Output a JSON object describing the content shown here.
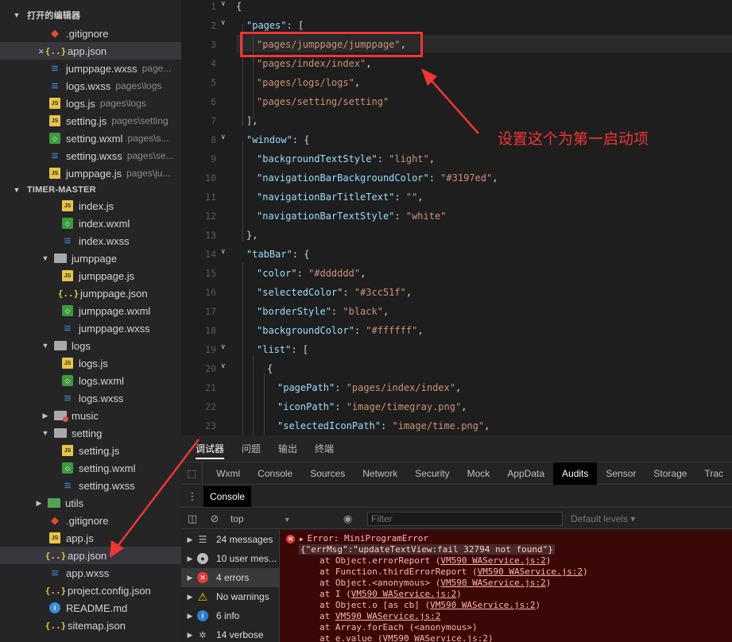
{
  "sidebar": {
    "open_editors_title": "打开的编辑器",
    "project_title": "TIMER-MASTER",
    "open_editors": [
      {
        "name": ".gitignore",
        "path": "",
        "icon": "git-icon",
        "closable": false
      },
      {
        "name": "app.json",
        "path": "",
        "icon": "json-icon",
        "closable": true,
        "selected": true
      },
      {
        "name": "jumppage.wxss",
        "path": "page...",
        "icon": "wxss-icon"
      },
      {
        "name": "logs.wxss",
        "path": "pages\\logs",
        "icon": "wxss-icon"
      },
      {
        "name": "logs.js",
        "path": "pages\\logs",
        "icon": "js-icon"
      },
      {
        "name": "setting.js",
        "path": "pages\\setting",
        "icon": "js-icon"
      },
      {
        "name": "setting.wxml",
        "path": "pages\\s...",
        "icon": "wxml-icon"
      },
      {
        "name": "setting.wxss",
        "path": "pages\\se...",
        "icon": "wxss-icon"
      },
      {
        "name": "jumppage.js",
        "path": "pages\\ju...",
        "icon": "js-icon"
      }
    ],
    "tree": [
      {
        "name": "index.js",
        "icon": "js-icon",
        "indent": 2
      },
      {
        "name": "index.wxml",
        "icon": "wxml-icon",
        "indent": 2
      },
      {
        "name": "index.wxss",
        "icon": "wxss-icon",
        "indent": 2
      },
      {
        "name": "jumppage",
        "icon": "folder-icon",
        "indent": 1,
        "expanded": true
      },
      {
        "name": "jumppage.js",
        "icon": "js-icon",
        "indent": 2
      },
      {
        "name": "jumppage.json",
        "icon": "json-icon",
        "indent": 2
      },
      {
        "name": "jumppage.wxml",
        "icon": "wxml-icon",
        "indent": 2
      },
      {
        "name": "jumppage.wxss",
        "icon": "wxss-icon",
        "indent": 2
      },
      {
        "name": "logs",
        "icon": "folder-icon",
        "indent": 1,
        "expanded": true
      },
      {
        "name": "logs.js",
        "icon": "js-icon",
        "indent": 2
      },
      {
        "name": "logs.wxml",
        "icon": "wxml-icon",
        "indent": 2
      },
      {
        "name": "logs.wxss",
        "icon": "wxss-icon",
        "indent": 2
      },
      {
        "name": "music",
        "icon": "folder-icon",
        "indent": 1,
        "expanded": false
      },
      {
        "name": "setting",
        "icon": "folder-icon",
        "indent": 1,
        "expanded": true
      },
      {
        "name": "setting.js",
        "icon": "js-icon",
        "indent": 2
      },
      {
        "name": "setting.wxml",
        "icon": "wxml-icon",
        "indent": 2
      },
      {
        "name": "setting.wxss",
        "icon": "wxss-icon",
        "indent": 2
      },
      {
        "name": "utils",
        "icon": "folder-icon",
        "indent": 0,
        "expanded": false
      },
      {
        "name": ".gitignore",
        "icon": "git-icon",
        "indent": 0
      },
      {
        "name": "app.js",
        "icon": "js-icon",
        "indent": 0
      },
      {
        "name": "app.json",
        "icon": "json-icon",
        "indent": 0,
        "selected": true
      },
      {
        "name": "app.wxss",
        "icon": "wxss-icon",
        "indent": 0
      },
      {
        "name": "project.config.json",
        "icon": "json-icon",
        "indent": 0
      },
      {
        "name": "README.md",
        "icon": "info-icon",
        "indent": 0
      },
      {
        "name": "sitemap.json",
        "icon": "json-icon",
        "indent": 0
      }
    ]
  },
  "editor": {
    "lines": [
      {
        "n": "1",
        "fold": true,
        "code": [
          [
            "p",
            "{"
          ]
        ]
      },
      {
        "n": "2",
        "fold": true,
        "indent": 1,
        "code": [
          [
            "k",
            "\"pages\""
          ],
          [
            "p",
            ": ["
          ]
        ]
      },
      {
        "n": "3",
        "indent": 2,
        "code": [
          [
            "s",
            "\"pages/jumppage/jumppage\""
          ],
          [
            "p",
            ","
          ]
        ]
      },
      {
        "n": "4",
        "indent": 2,
        "code": [
          [
            "s",
            "\"pages/index/index\""
          ],
          [
            "p",
            ","
          ]
        ]
      },
      {
        "n": "5",
        "indent": 2,
        "code": [
          [
            "s",
            "\"pages/logs/logs\""
          ],
          [
            "p",
            ","
          ]
        ]
      },
      {
        "n": "6",
        "indent": 2,
        "code": [
          [
            "s",
            "\"pages/setting/setting\""
          ]
        ]
      },
      {
        "n": "7",
        "indent": 1,
        "code": [
          [
            "p",
            "],"
          ]
        ]
      },
      {
        "n": "8",
        "fold": true,
        "indent": 1,
        "code": [
          [
            "k",
            "\"window\""
          ],
          [
            "p",
            ": {"
          ]
        ]
      },
      {
        "n": "9",
        "indent": 2,
        "code": [
          [
            "k",
            "\"backgroundTextStyle\""
          ],
          [
            "p",
            ": "
          ],
          [
            "s",
            "\"light\""
          ],
          [
            "p",
            ","
          ]
        ]
      },
      {
        "n": "10",
        "indent": 2,
        "code": [
          [
            "k",
            "\"navigationBarBackgroundColor\""
          ],
          [
            "p",
            ": "
          ],
          [
            "s",
            "\"#3197ed\""
          ],
          [
            "p",
            ","
          ]
        ]
      },
      {
        "n": "11",
        "indent": 2,
        "code": [
          [
            "k",
            "\"navigationBarTitleText\""
          ],
          [
            "p",
            ": "
          ],
          [
            "s",
            "\"\""
          ],
          [
            "p",
            ","
          ]
        ]
      },
      {
        "n": "12",
        "indent": 2,
        "code": [
          [
            "k",
            "\"navigationBarTextStyle\""
          ],
          [
            "p",
            ": "
          ],
          [
            "s",
            "\"white\""
          ]
        ]
      },
      {
        "n": "13",
        "indent": 1,
        "code": [
          [
            "p",
            "},"
          ]
        ]
      },
      {
        "n": "14",
        "fold": true,
        "indent": 1,
        "code": [
          [
            "k",
            "\"tabBar\""
          ],
          [
            "p",
            ": {"
          ]
        ]
      },
      {
        "n": "15",
        "indent": 2,
        "code": [
          [
            "k",
            "\"color\""
          ],
          [
            "p",
            ": "
          ],
          [
            "s",
            "\"#dddddd\""
          ],
          [
            "p",
            ","
          ]
        ]
      },
      {
        "n": "16",
        "indent": 2,
        "code": [
          [
            "k",
            "\"selectedColor\""
          ],
          [
            "p",
            ": "
          ],
          [
            "s",
            "\"#3cc51f\""
          ],
          [
            "p",
            ","
          ]
        ]
      },
      {
        "n": "17",
        "indent": 2,
        "code": [
          [
            "k",
            "\"borderStyle\""
          ],
          [
            "p",
            ": "
          ],
          [
            "s",
            "\"black\""
          ],
          [
            "p",
            ","
          ]
        ]
      },
      {
        "n": "18",
        "indent": 2,
        "code": [
          [
            "k",
            "\"backgroundColor\""
          ],
          [
            "p",
            ": "
          ],
          [
            "s",
            "\"#ffffff\""
          ],
          [
            "p",
            ","
          ]
        ]
      },
      {
        "n": "19",
        "fold": true,
        "indent": 2,
        "code": [
          [
            "k",
            "\"list\""
          ],
          [
            "p",
            ": ["
          ]
        ]
      },
      {
        "n": "20",
        "fold": true,
        "indent": 3,
        "code": [
          [
            "p",
            "{"
          ]
        ]
      },
      {
        "n": "21",
        "indent": 4,
        "code": [
          [
            "k",
            "\"pagePath\""
          ],
          [
            "p",
            ": "
          ],
          [
            "s",
            "\"pages/index/index\""
          ],
          [
            "p",
            ","
          ]
        ]
      },
      {
        "n": "22",
        "indent": 4,
        "code": [
          [
            "k",
            "\"iconPath\""
          ],
          [
            "p",
            ": "
          ],
          [
            "s",
            "\"image/timegray.png\""
          ],
          [
            "p",
            ","
          ]
        ]
      },
      {
        "n": "23",
        "indent": 4,
        "code": [
          [
            "k",
            "\"selectedIconPath\""
          ],
          [
            "p",
            ": "
          ],
          [
            "s",
            "\"image/time.png\""
          ],
          [
            "p",
            ","
          ]
        ]
      }
    ],
    "annotation": "设置这个为第一启动项"
  },
  "devtools": {
    "top_tabs": [
      "调试器",
      "问题",
      "输出",
      "终端"
    ],
    "panel_tabs": [
      "Wxml",
      "Console",
      "Sources",
      "Network",
      "Security",
      "Mock",
      "AppData",
      "Audits",
      "Sensor",
      "Storage",
      "Trac"
    ],
    "active_panel": "Audits",
    "console_tab": "Console",
    "context": "top",
    "filter_placeholder": "Filter",
    "levels": "Default levels ▾",
    "sidebar": [
      {
        "label": "24 messages",
        "icon": "list-icon"
      },
      {
        "label": "10 user mes...",
        "icon": "user-icon"
      },
      {
        "label": "4 errors",
        "icon": "error-icon"
      },
      {
        "label": "No warnings",
        "icon": "warning-icon"
      },
      {
        "label": "6 info",
        "icon": "info-icon"
      },
      {
        "label": "14 verbose",
        "icon": "verbose-icon"
      }
    ],
    "error": {
      "title": "Error: MiniProgramError",
      "msg": "{\"errMsg\":\"updateTextView:fail 32794 not found\"}",
      "stack": [
        [
          "at Object.errorReport (",
          "VM590 WAService.js:2",
          ")"
        ],
        [
          "at Function.thirdErrorReport (",
          "VM590 WAService.js:2",
          ")"
        ],
        [
          "at Object.<anonymous> (",
          "VM590 WAService.js:2",
          ")"
        ],
        [
          "at I (",
          "VM590 WAService.js:2",
          ")"
        ],
        [
          "at Object.o [as cb] (",
          "VM590 WAService.js:2",
          ")"
        ],
        [
          "at ",
          "VM590 WAService.js:2",
          ""
        ],
        [
          "at Array.forEach (<anonymous>)",
          "",
          ""
        ],
        [
          "at e.value (",
          "VM590 WAService.js:2",
          ")"
        ]
      ]
    }
  }
}
